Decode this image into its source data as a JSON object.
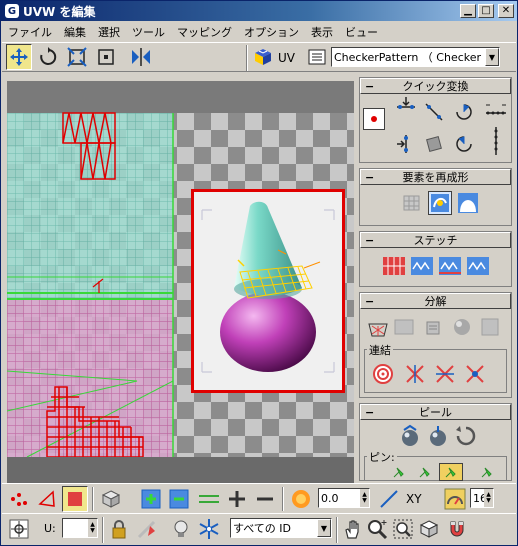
{
  "window": {
    "title": "UVW を編集",
    "app_icon": "G"
  },
  "menu": [
    "ファイル",
    "編集",
    "選択",
    "ツール",
    "マッピング",
    "オプション",
    "表示",
    "ビュー"
  ],
  "toolbar": {
    "uv_label": "UV",
    "map_select": "CheckerPattern （ Checker ）"
  },
  "panel": {
    "quick_transform": "クイック変換",
    "reshape": "要素を再成形",
    "stitch": "ステッチ",
    "explode": "分解",
    "weld": "連結",
    "peel": "ピール",
    "pin": "ピン:"
  },
  "bottom": {
    "offset_value": "0.0",
    "axis_label": "XY",
    "grid_value": "16",
    "u_label": "U:",
    "u_value": "",
    "id_filter": "すべての ID"
  },
  "colors": {
    "selection_red": "#e00000",
    "mesh_cyan": "#7ad9c8",
    "mesh_pink": "#c060a0",
    "accent_green": "#38d838"
  }
}
